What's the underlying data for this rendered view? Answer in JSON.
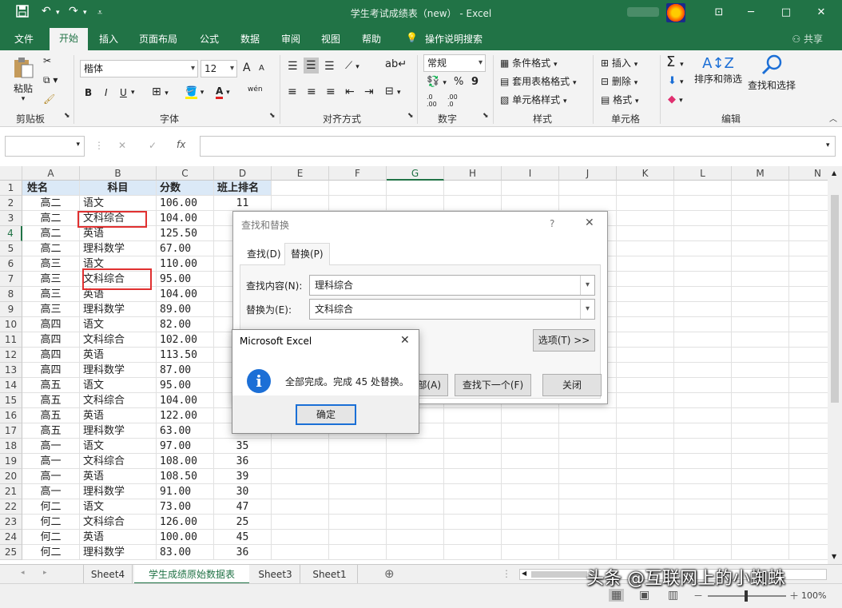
{
  "window": {
    "title": "学生考试成绩表（new） - Excel",
    "buttons": [
      "─",
      "□",
      "✕"
    ],
    "ribbon_toggle": "⊡"
  },
  "menu": {
    "tabs": [
      "文件",
      "开始",
      "插入",
      "页面布局",
      "公式",
      "数据",
      "审阅",
      "视图",
      "帮助"
    ],
    "active_tab": "开始",
    "tell_me": "操作说明搜索",
    "share": "共享"
  },
  "ribbon": {
    "clipboard": {
      "paste": "粘贴",
      "label": "剪贴板"
    },
    "font": {
      "name": "楷体",
      "size": "12",
      "bold": "B",
      "italic": "I",
      "underline": "U",
      "label": "字体",
      "grow": "A",
      "shrink": "A",
      "phonetic": "wén"
    },
    "alignment": {
      "label": "对齐方式"
    },
    "number": {
      "format": "常规",
      "percent": "%",
      "comma": "9",
      "label": "数字",
      "inc_decimal": ".0 .00",
      "dec_decimal": ".00 .0"
    },
    "styles": {
      "conditional": "条件格式",
      "table": "套用表格格式",
      "cell": "单元格样式",
      "label": "样式"
    },
    "cells": {
      "insert": "插入",
      "delete": "删除",
      "format": "格式",
      "label": "单元格"
    },
    "editing": {
      "sort": "排序和筛选",
      "find": "查找和选择",
      "label": "编辑"
    }
  },
  "formula_bar": {
    "cancel": "✕",
    "confirm": "✓",
    "fx": "fx",
    "value": ""
  },
  "columns": [
    "A",
    "B",
    "C",
    "D",
    "E",
    "F",
    "G",
    "H",
    "I",
    "J",
    "K",
    "L",
    "M",
    "N"
  ],
  "header_row": [
    "姓名",
    "科目",
    "分数",
    "班上排名"
  ],
  "rows": [
    [
      "高二",
      "语文",
      "106.00",
      "11"
    ],
    [
      "高二",
      "文科综合",
      "104.00",
      ""
    ],
    [
      "高二",
      "英语",
      "125.50",
      ""
    ],
    [
      "高二",
      "理科数学",
      "67.00",
      ""
    ],
    [
      "高三",
      "语文",
      "110.00",
      ""
    ],
    [
      "高三",
      "文科综合",
      "95.00",
      ""
    ],
    [
      "高三",
      "英语",
      "104.00",
      ""
    ],
    [
      "高三",
      "理科数学",
      "89.00",
      ""
    ],
    [
      "高四",
      "语文",
      "82.00",
      ""
    ],
    [
      "高四",
      "文科综合",
      "102.00",
      ""
    ],
    [
      "高四",
      "英语",
      "113.50",
      ""
    ],
    [
      "高四",
      "理科数学",
      "87.00",
      ""
    ],
    [
      "高五",
      "语文",
      "95.00",
      ""
    ],
    [
      "高五",
      "文科综合",
      "104.00",
      ""
    ],
    [
      "高五",
      "英语",
      "122.00",
      ""
    ],
    [
      "高五",
      "理科数学",
      "63.00",
      ""
    ],
    [
      "高一",
      "语文",
      "97.00",
      "35"
    ],
    [
      "高一",
      "文科综合",
      "108.00",
      "36"
    ],
    [
      "高一",
      "英语",
      "108.50",
      "39"
    ],
    [
      "高一",
      "理科数学",
      "91.00",
      "30"
    ],
    [
      "何二",
      "语文",
      "73.00",
      "47"
    ],
    [
      "何二",
      "文科综合",
      "126.00",
      "25"
    ],
    [
      "何二",
      "英语",
      "100.00",
      "45"
    ],
    [
      "何二",
      "理科数学",
      "83.00",
      "36"
    ]
  ],
  "sheets": {
    "tabs": [
      "Sheet4",
      "学生成绩原始数据表",
      "Sheet3",
      "Sheet1"
    ],
    "active": "学生成绩原始数据表",
    "add": "⊕"
  },
  "status": {
    "zoom": "100%",
    "minus": "－",
    "plus": "＋"
  },
  "find_replace": {
    "title": "查找和替换",
    "help": "?",
    "close": "✕",
    "tab_find": "查找(D)",
    "tab_replace": "替换(P)",
    "find_label": "查找内容(N):",
    "find_value": "理科综合",
    "replace_label": "替换为(E):",
    "replace_value": "文科综合",
    "options_button": "选项(T) >>",
    "replace_all_partial": "部(A)",
    "find_next_button": "查找下一个(F)",
    "close_button": "关闭"
  },
  "message_box": {
    "title": "Microsoft Excel",
    "close": "✕",
    "icon": "i",
    "text": "全部完成。完成 45 处替换。",
    "ok_button": "确定"
  },
  "watermark": "头条 @互联网上的小蜘蛛",
  "colors": {
    "excel_green": "#217346",
    "header_fill": "#dbe9f7",
    "highlight_box": "#e03030",
    "info_blue": "#1c6fd6"
  }
}
